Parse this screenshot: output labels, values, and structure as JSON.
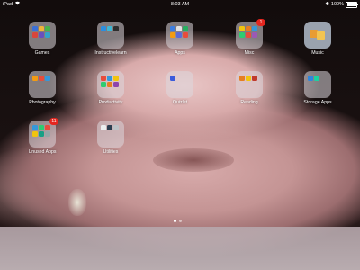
{
  "status_bar": {
    "carrier": "iPad",
    "time": "8:03 AM",
    "battery": "100%"
  },
  "apps": [
    {
      "label": "Games",
      "type": "folder",
      "badge": ""
    },
    {
      "label": "Instructivelearn",
      "type": "folder",
      "badge": ""
    },
    {
      "label": "Apps",
      "type": "folder",
      "badge": ""
    },
    {
      "label": "Misc",
      "type": "folder",
      "badge": "1"
    },
    {
      "label": "Music",
      "type": "app",
      "badge": ""
    },
    {
      "label": "Photography",
      "type": "folder",
      "badge": ""
    },
    {
      "label": "Productivity",
      "type": "folder",
      "badge": ""
    },
    {
      "label": "Quizlet",
      "type": "folder",
      "badge": ""
    },
    {
      "label": "Reading",
      "type": "folder",
      "badge": ""
    },
    {
      "label": "Storage Apps",
      "type": "folder",
      "badge": ""
    },
    {
      "label": "Unused Apps",
      "type": "folder",
      "badge": "11"
    },
    {
      "label": "Utilities",
      "type": "folder",
      "badge": ""
    }
  ],
  "colors": {
    "badge": "#e5261f",
    "folder_bg": "rgba(220,215,220,0.55)"
  }
}
